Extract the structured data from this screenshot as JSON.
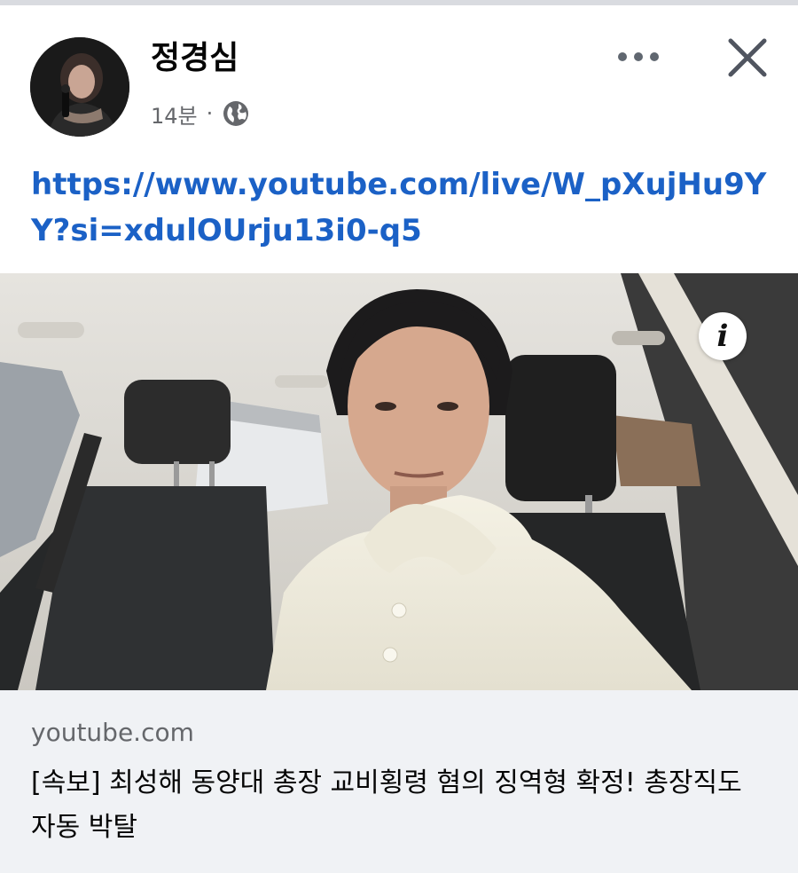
{
  "post": {
    "author": "정경심",
    "time": "14분",
    "separator": "·",
    "privacy_icon": "globe-icon",
    "link_text": "https://www.youtube.com/live/W_pXujHu9YY?si=xdulOUrju13i0-q5"
  },
  "header_actions": {
    "more_icon": "more-horizontal-icon",
    "close_icon": "close-icon"
  },
  "link_preview": {
    "info_glyph": "i",
    "domain": "youtube.com",
    "title": "[속보] 최성해 동양대 총장 교비횡령 혐의 징역형 확정! 총장직도 자동 박탈"
  },
  "colors": {
    "link": "#1b61c6",
    "name": "#050505",
    "meta": "#65676b",
    "footer_bg": "#f0f2f5"
  }
}
